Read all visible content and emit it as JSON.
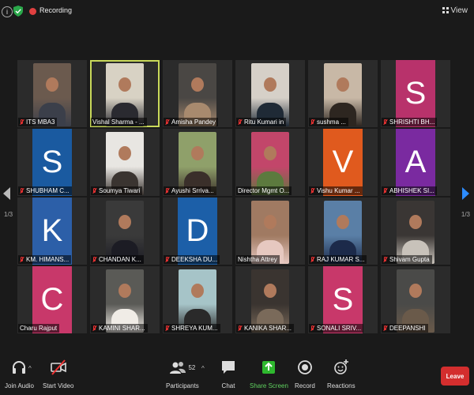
{
  "topbar": {
    "recording_label": "Recording",
    "view_label": "View"
  },
  "pagination": {
    "left": "1/3",
    "right": "1/3"
  },
  "colors": {
    "active_border": "#c9d95a",
    "recording": "#e04040",
    "next_arrow": "#2d8cff",
    "leave": "#d32e2e"
  },
  "participants": [
    {
      "name": "ITS MBA3",
      "type": "photo",
      "muted": true
    },
    {
      "name": "Vishal Sharma - ...",
      "type": "photo",
      "muted": false,
      "active": true
    },
    {
      "name": "Amisha Pandey",
      "type": "photo",
      "muted": true
    },
    {
      "name": "Ritu Kumari in",
      "type": "photo",
      "muted": true
    },
    {
      "name": "sushma ...",
      "type": "photo",
      "muted": true
    },
    {
      "name": "SHRISHTI BH...",
      "type": "initial",
      "initial": "S",
      "color": "#b8326b",
      "muted": true
    },
    {
      "name": "SHUBHAM C...",
      "type": "initial",
      "initial": "S",
      "color": "#1a5aa0",
      "muted": true
    },
    {
      "name": "Soumya Tiwari",
      "type": "photo",
      "muted": true
    },
    {
      "name": "Ayushi Srriva...",
      "type": "photo",
      "muted": true
    },
    {
      "name": "Director Mgmt O...",
      "type": "photo",
      "muted": false
    },
    {
      "name": "Vishu Kumar ...",
      "type": "initial",
      "initial": "V",
      "color": "#e05a1e",
      "muted": true
    },
    {
      "name": "ABHISHEK SI...",
      "type": "initial",
      "initial": "A",
      "color": "#7a2aa0",
      "muted": true
    },
    {
      "name": "KM. HIMANS...",
      "type": "initial",
      "initial": "K",
      "color": "#2c5fa8",
      "muted": true
    },
    {
      "name": "CHANDAN K...",
      "type": "photo",
      "muted": true
    },
    {
      "name": "DEEKSHA DU...",
      "type": "initial",
      "initial": "D",
      "color": "#1c5fa8",
      "muted": true
    },
    {
      "name": "Nishtha Attrey",
      "type": "photo",
      "muted": false
    },
    {
      "name": "RAJ KUMAR S...",
      "type": "photo",
      "muted": true
    },
    {
      "name": "Shivam Gupta",
      "type": "photo",
      "muted": true
    },
    {
      "name": "Charu Rajput",
      "type": "initial",
      "initial": "C",
      "color": "#c8386a",
      "muted": false
    },
    {
      "name": "KAMINI SHAR...",
      "type": "photo",
      "muted": true
    },
    {
      "name": "SHREYA KUM...",
      "type": "photo",
      "muted": true
    },
    {
      "name": "KANIKA SHAR...",
      "type": "photo",
      "muted": true
    },
    {
      "name": "SONALI SRIV...",
      "type": "initial",
      "initial": "S",
      "color": "#c8386a",
      "muted": true
    },
    {
      "name": "DEEPANSHI",
      "type": "photo",
      "muted": true
    }
  ],
  "toolbar": {
    "join_audio": "Join Audio",
    "start_video": "Start Video",
    "participants": "Participants",
    "participants_count": "52",
    "chat": "Chat",
    "share_screen": "Share Screen",
    "record": "Record",
    "reactions": "Reactions",
    "leave": "Leave"
  }
}
